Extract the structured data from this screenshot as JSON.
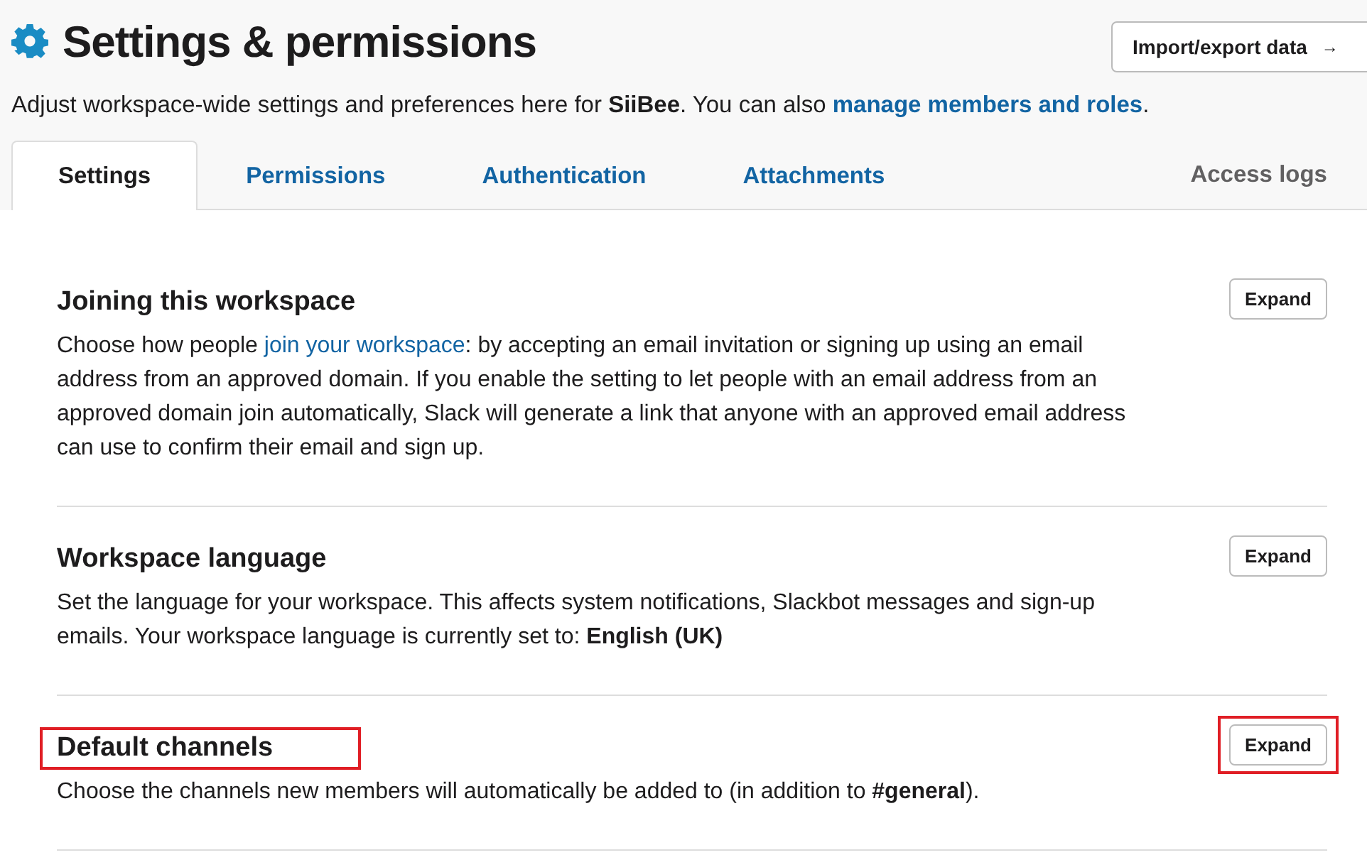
{
  "header": {
    "title": "Settings & permissions",
    "action_button": {
      "label": "Import/export data",
      "arrow": "→"
    },
    "subtitle": [
      {
        "kind": "text",
        "text": "Adjust workspace-wide settings and preferences here for "
      },
      {
        "kind": "bold",
        "text": "SiiBee"
      },
      {
        "kind": "text",
        "text": ". You can also "
      },
      {
        "kind": "link",
        "text": "manage members and roles"
      },
      {
        "kind": "text",
        "text": "."
      }
    ]
  },
  "tabs": [
    {
      "label": "Settings",
      "selected": true
    },
    {
      "label": "Permissions",
      "selected": false
    },
    {
      "label": "Authentication",
      "selected": false
    },
    {
      "label": "Attachments",
      "selected": false
    }
  ],
  "access_logs": {
    "label": "Access logs"
  },
  "sections": [
    {
      "title": "Joining this workspace",
      "title_highlighted": false,
      "button": "Expand",
      "button_highlighted": false,
      "description": [
        {
          "kind": "text",
          "text": "Choose how people "
        },
        {
          "kind": "link",
          "text": "join your workspace"
        },
        {
          "kind": "text",
          "text": ": by accepting an email invitation or signing up using an email address from an approved domain. If you enable the setting to let people with an email address from an approved domain join automatically, Slack will generate a link that anyone with an approved email address can use to confirm their email and sign up."
        }
      ]
    },
    {
      "title": "Workspace language",
      "title_highlighted": false,
      "button": "Expand",
      "button_highlighted": false,
      "description": [
        {
          "kind": "text",
          "text": "Set the language for your workspace. This affects system notifications, Slackbot messages and sign-up emails. Your workspace language is currently set to: "
        },
        {
          "kind": "bold",
          "text": "English (UK)"
        }
      ]
    },
    {
      "title": "Default channels",
      "title_highlighted": true,
      "button": "Expand",
      "button_highlighted": true,
      "description": [
        {
          "kind": "text",
          "text": "Choose the channels new members will automatically be added to (in addition to "
        },
        {
          "kind": "bold",
          "text": "#general"
        },
        {
          "kind": "text",
          "text": ")."
        }
      ]
    }
  ]
}
